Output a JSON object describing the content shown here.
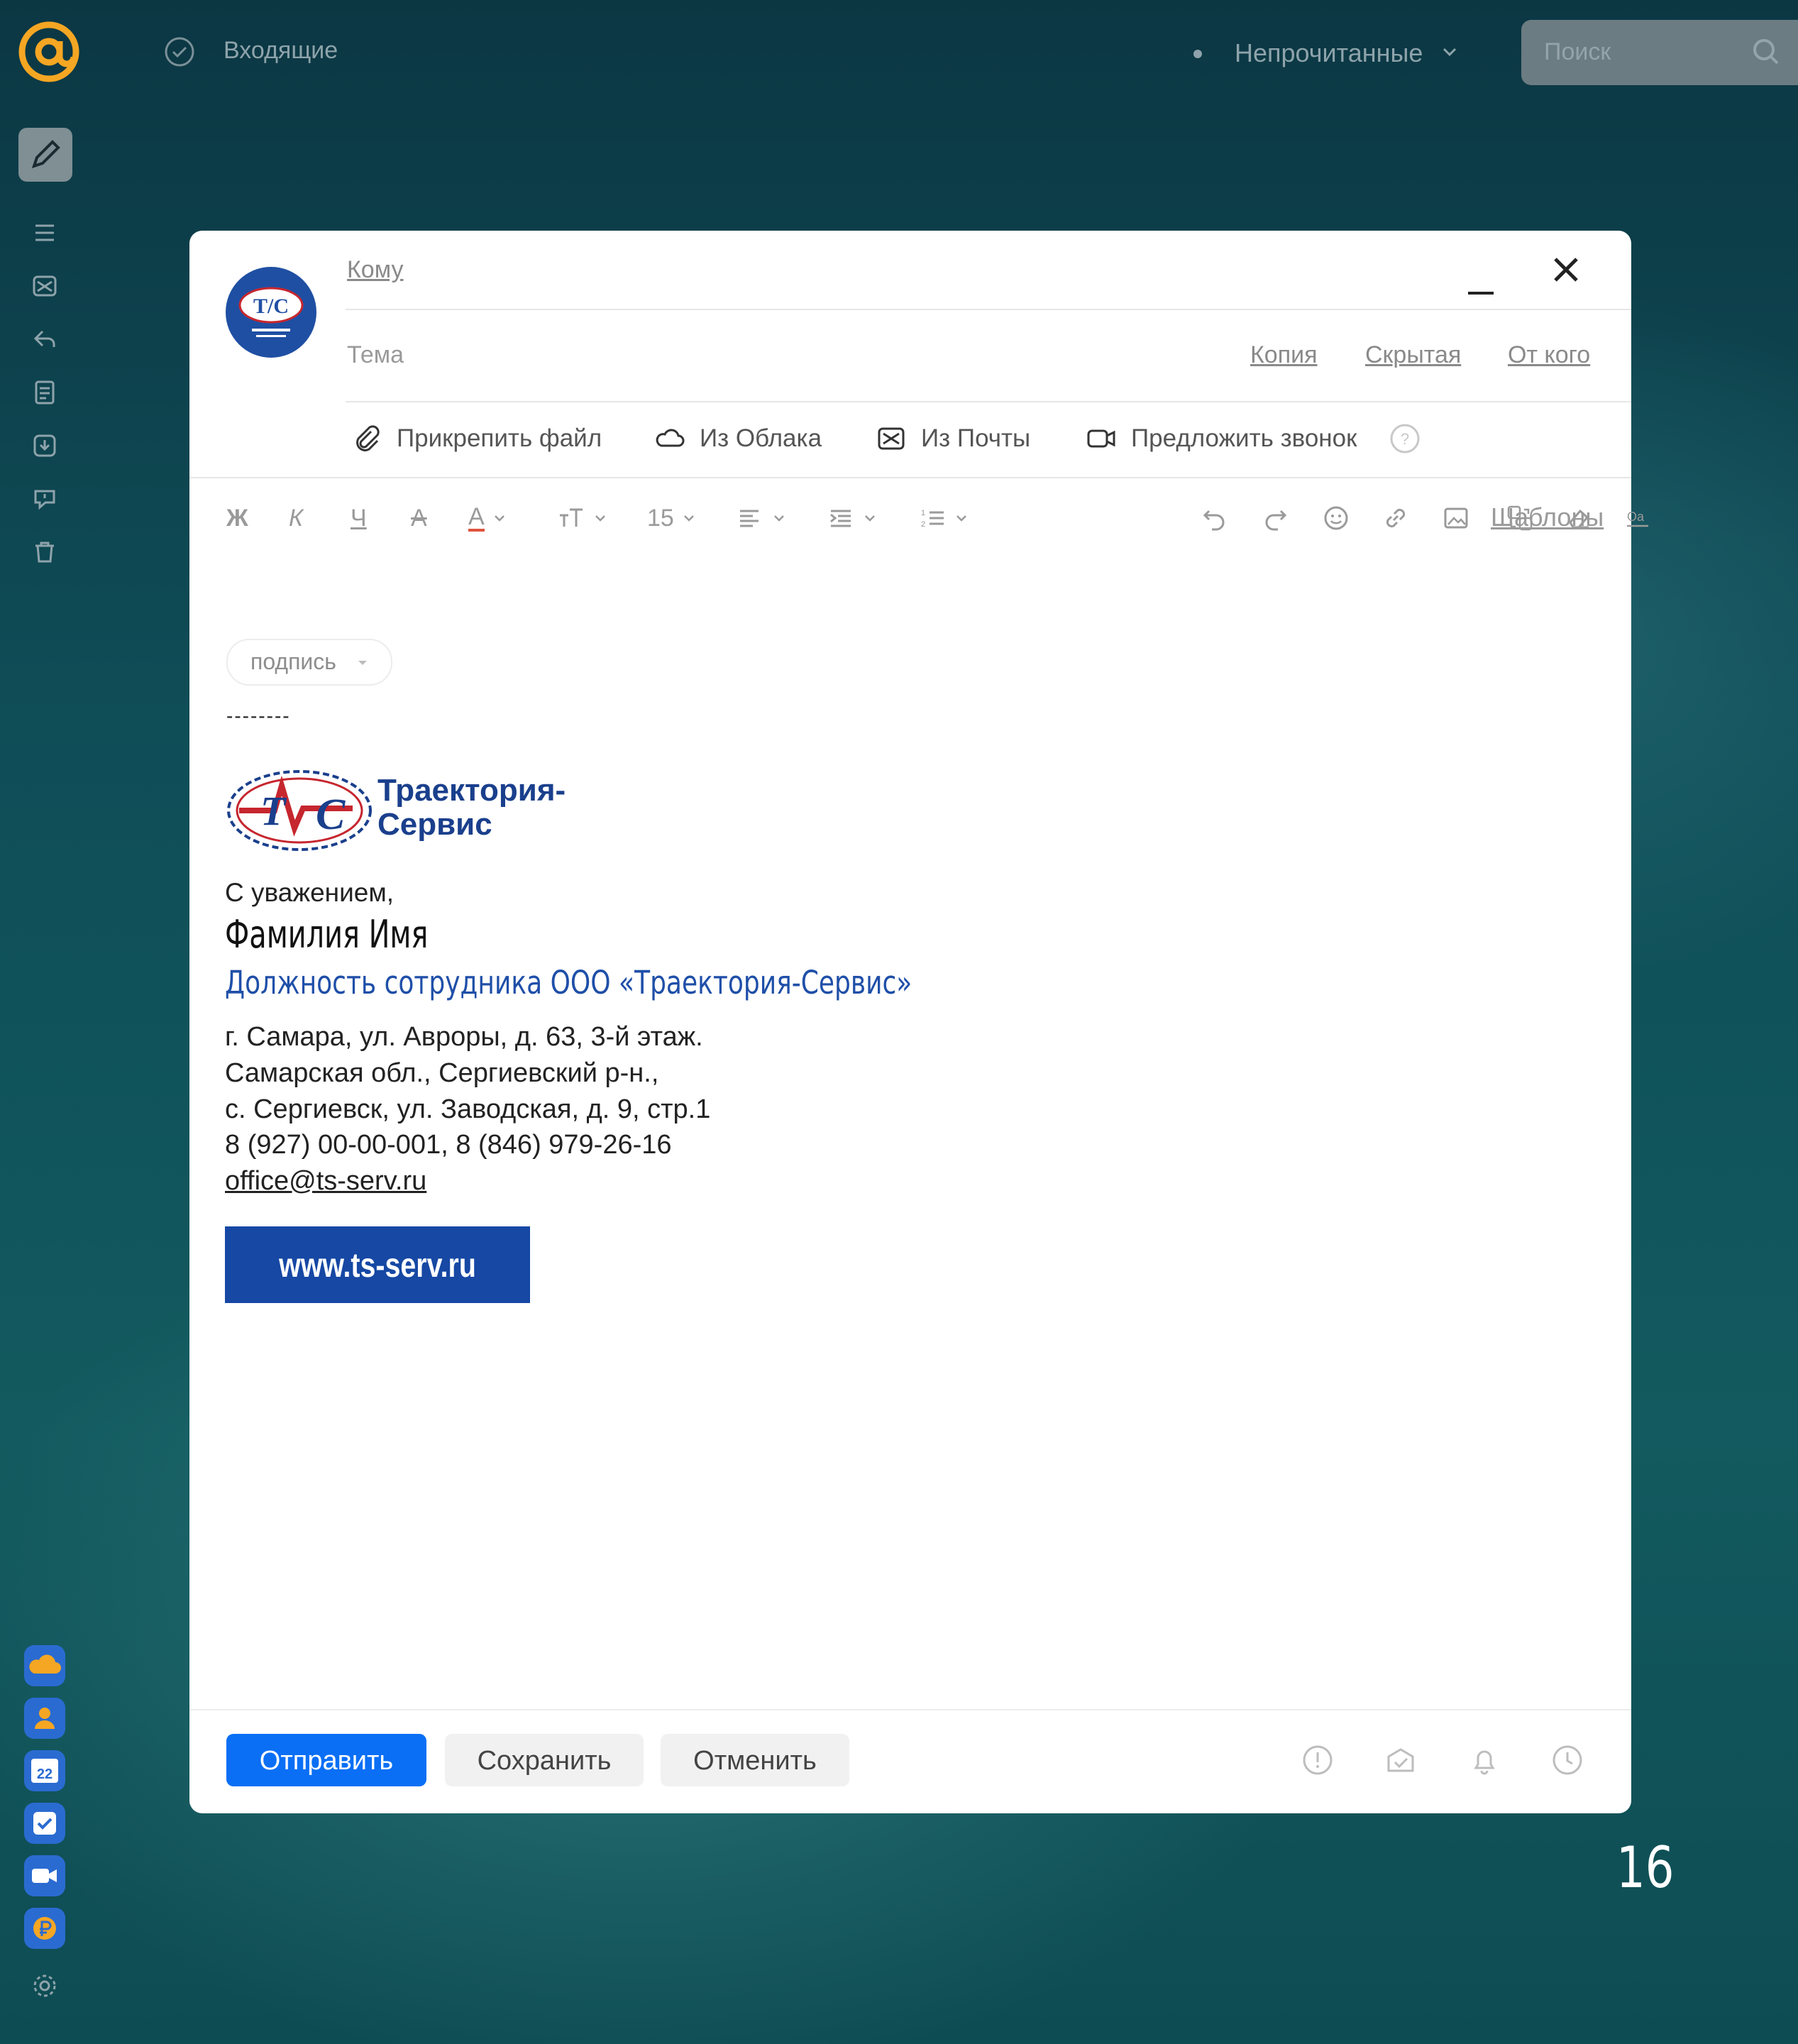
{
  "topbar": {
    "folder_label": "Входящие",
    "filter_label": "Непрочитанные",
    "search_placeholder": "Поиск"
  },
  "compose": {
    "to_label": "Кому",
    "subject_label": "Тема",
    "cc_label": "Копия",
    "bcc_label": "Скрытая",
    "from_label": "От кого",
    "attach": [
      {
        "label": "Прикрепить файл",
        "icon": "paperclip-icon"
      },
      {
        "label": "Из Облака",
        "icon": "cloud-icon"
      },
      {
        "label": "Из Почты",
        "icon": "mail-icon"
      },
      {
        "label": "Предложить звонок",
        "icon": "video-call-icon"
      }
    ],
    "toolbar": {
      "bold": "Ж",
      "italic": "К",
      "underline": "Ч",
      "strike": "A",
      "font_color": "A",
      "font_size": "15",
      "templates_label": "Шаблоны"
    },
    "signature_chip": "подпись",
    "dashes": "--------",
    "signature": {
      "company_line1": "Траектория-",
      "company_line2": "Сервис",
      "logo_text": "Т/С",
      "regards": "С уважением,",
      "name": "Фамилия Имя",
      "position": "Должность сотрудника ООО «Траектория-Сервис»",
      "address1": "г. Самара, ул. Авроры, д. 63, 3-й этаж.",
      "address2": "Самарская обл., Сергиевский р-н.,",
      "address3": "с. Сергиевск, ул. Заводская, д. 9, стр.1",
      "phones": "8 (927) 00-00-001, 8 (846) 979-26-16",
      "email": "office@ts-serv.ru",
      "website": "www.ts-serv.ru"
    },
    "buttons": {
      "send": "Отправить",
      "save": "Сохранить",
      "cancel": "Отменить"
    }
  },
  "page_number": "16",
  "colors": {
    "accent": "#0a6ff5",
    "brand_blue": "#1648a4",
    "logo_orange": "#f5a623"
  }
}
